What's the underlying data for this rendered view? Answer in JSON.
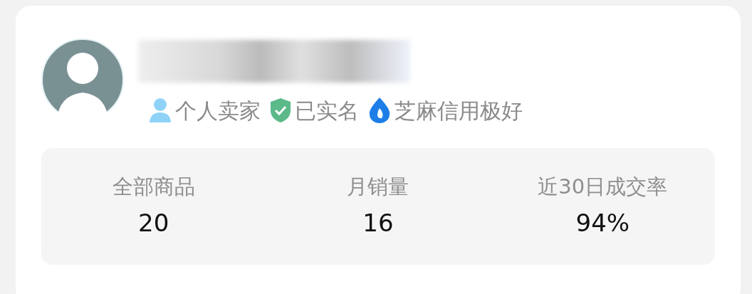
{
  "profile": {
    "name": {
      "kind": "redacted"
    },
    "badges": [
      {
        "kind": "person",
        "label": "个人卖家"
      },
      {
        "kind": "shield",
        "label": "已实名"
      },
      {
        "kind": "drop",
        "label": "芝麻信用极好"
      }
    ]
  },
  "stats": [
    {
      "label": "全部商品",
      "value": "20"
    },
    {
      "label": "月销量",
      "value": "16"
    },
    {
      "label": "近30日成交率",
      "value": "94%"
    }
  ]
}
